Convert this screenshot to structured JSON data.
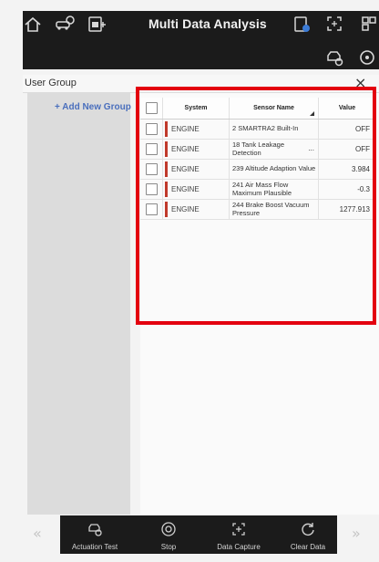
{
  "header": {
    "title": "Multi Data Analysis",
    "icons": [
      "home-icon",
      "vehicle-settings-icon",
      "scanner-icon",
      "battery-icon",
      "capture-icon",
      "grid-icon",
      "vehicle-check-icon",
      "wheel-icon"
    ]
  },
  "user_group": {
    "label": "User Group",
    "close": "×",
    "add_group": "+ Add New Group"
  },
  "table": {
    "columns": [
      "System",
      "Sensor Name",
      "Value"
    ],
    "rows": [
      {
        "system": "ENGINE",
        "sensor": "2 SMARTRA2 Built-In",
        "value": "OFF",
        "ellipsis": ""
      },
      {
        "system": "ENGINE",
        "sensor": "18 Tank Leakage Detection",
        "value": "OFF",
        "ellipsis": "..."
      },
      {
        "system": "ENGINE",
        "sensor": "239 Altitude Adaption Value",
        "value": "3.984",
        "ellipsis": ""
      },
      {
        "system": "ENGINE",
        "sensor": "241 Air Mass Flow Maximum Plausible",
        "value": "-0.3",
        "ellipsis": ""
      },
      {
        "system": "ENGINE",
        "sensor": "244 Brake Boost Vacuum Pressure",
        "value": "1277.913",
        "ellipsis": ""
      }
    ]
  },
  "bottom_bar": {
    "items": [
      {
        "label": "Actuation Test",
        "icon": "car-test-icon"
      },
      {
        "label": "Stop",
        "icon": "stop-icon"
      },
      {
        "label": "Data Capture",
        "icon": "capture-icon"
      },
      {
        "label": "Clear Data",
        "icon": "refresh-icon"
      }
    ],
    "prev": "«",
    "next": "»"
  },
  "colors": {
    "header_bg": "#1b1b1b",
    "highlight": "#e3000f",
    "system_marker": "#c0392b",
    "add_group": "#4a6fbd"
  }
}
